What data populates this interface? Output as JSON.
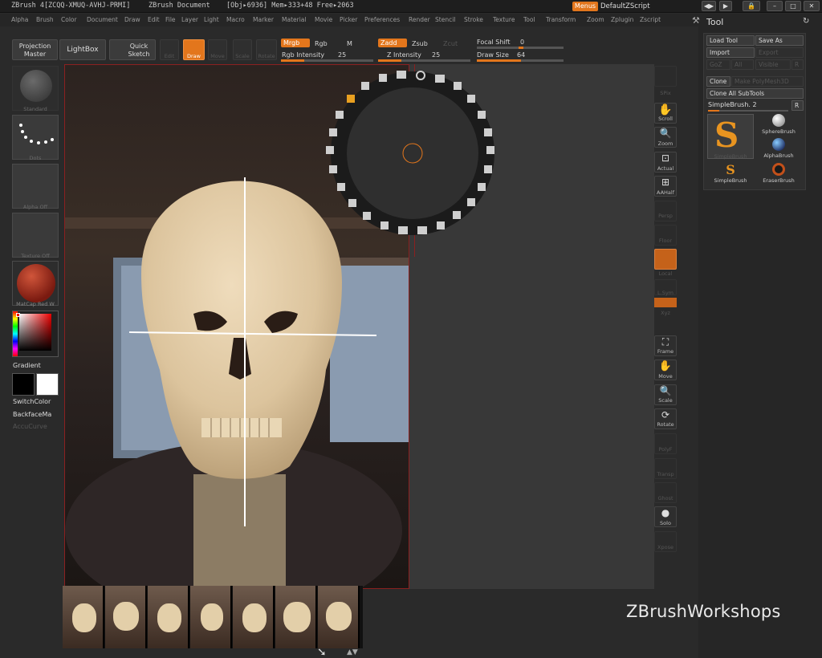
{
  "titlebar": {
    "app": "ZBrush 4[ZCQQ-XMUQ-AVHJ-PRMI]",
    "document": "ZBrush Document",
    "stats": "[Obj▸6936] Mem▸333+48 Free▸2063",
    "menus_label": "Menus",
    "script_label": "DefaultZScript"
  },
  "menubar": [
    "Alpha",
    "Brush",
    "Color",
    "Document",
    "Draw",
    "Edit",
    "File",
    "Layer",
    "Light",
    "Macro",
    "Marker",
    "Material",
    "Movie",
    "Picker",
    "Preferences",
    "Render",
    "Stencil",
    "Stroke",
    "Texture",
    "Tool",
    "Transform",
    "Zoom",
    "Zplugin",
    "Zscript"
  ],
  "toolbar": {
    "projection_master": "Projection Master",
    "lightbox": "LightBox",
    "quick_sketch": "Quick Sketch",
    "edit": "Edit",
    "draw": "Draw",
    "move": "Move",
    "scale": "Scale",
    "rotate": "Rotate",
    "mrgb": "Mrgb",
    "rgb": "Rgb",
    "m": "M",
    "zadd": "Zadd",
    "zsub": "Zsub",
    "zcut": "Zcut",
    "rgb_intensity_label": "Rgb Intensity",
    "rgb_intensity": 25,
    "z_intensity_label": "Z Intensity",
    "z_intensity": 25,
    "focal_shift_label": "Focal Shift",
    "focal_shift": 0,
    "draw_size_label": "Draw Size",
    "draw_size": 64
  },
  "leftshelf": {
    "brush_caption": "Standard",
    "stroke_caption": "Dots",
    "alpha_caption": "Alpha Off",
    "texture_caption": "Texture Off",
    "material_caption": "MatCap Red W",
    "gradient": "Gradient",
    "switchcolor": "SwitchColor",
    "backfacemask": "BackfaceMa",
    "accucurve": "AccuCurve"
  },
  "rightshelf": {
    "spix": "SPix",
    "scroll": "Scroll",
    "zoom": "Zoom",
    "actual": "Actual",
    "aahalf": "AAHalf",
    "persp": "Persp",
    "floor": "Floor",
    "local": "Local",
    "lsym": "L.Sym",
    "xyz": "Xyz",
    "frame": "Frame",
    "move": "Move",
    "scale": "Scale",
    "rotate": "Rotate",
    "polyf": "PolyF",
    "transp": "Transp",
    "ghost": "Ghost",
    "solo": "Solo",
    "xpose": "Xpose"
  },
  "toolpanel": {
    "title": "Tool",
    "load_tool": "Load Tool",
    "save_as": "Save As",
    "import": "Import",
    "export": "Export",
    "goz": "GoZ",
    "all": "All",
    "visible": "Visible",
    "r": "R",
    "clone": "Clone",
    "make_polymesh": "Make PolyMesh3D",
    "clone_all": "Clone All SubTools",
    "current_tool": "SimpleBrush. 2",
    "r2": "R",
    "brushes": [
      {
        "name": "SimpleBrush"
      },
      {
        "name": "SphereBrush"
      },
      {
        "name": "AlphaBrush"
      },
      {
        "name": "SimpleBrush"
      },
      {
        "name": "EraserBrush"
      }
    ]
  },
  "watermark": "ZBrushWorkshops",
  "colors": {
    "accent": "#e3761c",
    "canvas_border": "#8b2020",
    "background": "#2a2a2a"
  }
}
